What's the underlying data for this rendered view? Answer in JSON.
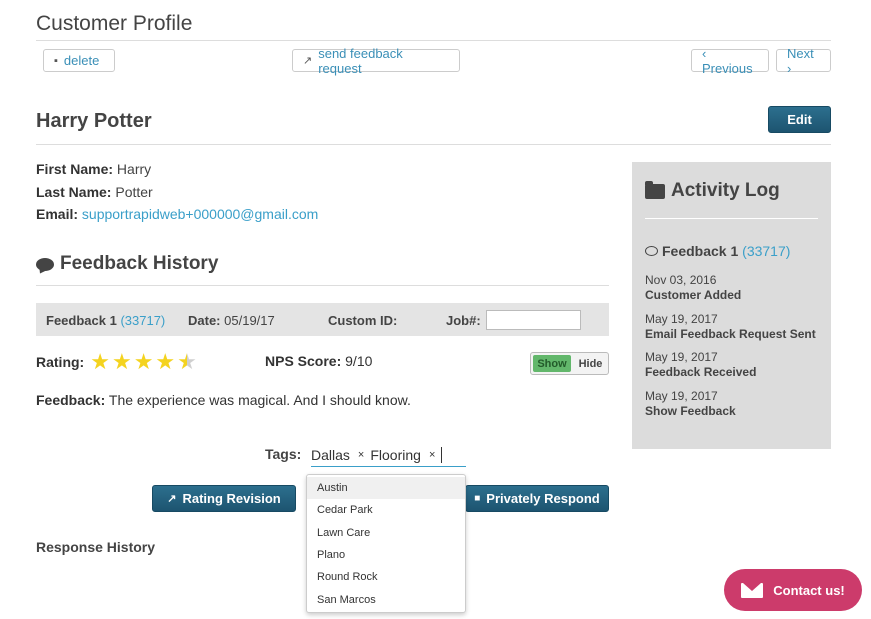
{
  "page": {
    "title": "Customer Profile"
  },
  "toolbar": {
    "delete_label": "delete",
    "send_feedback_label": "send feedback request",
    "previous_label": "‹ Previous",
    "next_label": "Next ›"
  },
  "customer": {
    "full_name": "Harry Potter",
    "edit_label": "Edit",
    "first_name_label": "First Name:",
    "first_name": "Harry",
    "last_name_label": "Last Name:",
    "last_name": "Potter",
    "email_label": "Email:",
    "email": "supportrapidweb+000000@gmail.com"
  },
  "feedback_history": {
    "title": "Feedback History",
    "feedback_label": "Feedback 1",
    "feedback_id": "(33717)",
    "date_label": "Date:",
    "date": "05/19/17",
    "custom_id_label": "Custom ID:",
    "job_label": "Job#:",
    "job_value": "",
    "rating_label": "Rating:",
    "rating_value": 4.5,
    "rating_max": 5,
    "nps_label": "NPS Score:",
    "nps_value": "9/10",
    "toggle_show": "Show",
    "toggle_hide": "Hide",
    "feedback_text_label": "Feedback:",
    "feedback_text": "The experience was magical. And I should know.",
    "tags_label": "Tags:",
    "tags": [
      "Dallas",
      "Flooring"
    ],
    "tag_remove": "×",
    "tag_options": [
      "Austin",
      "Cedar Park",
      "Lawn Care",
      "Plano",
      "Round Rock",
      "San Marcos"
    ],
    "rating_revision_label": "Rating Revision",
    "privately_respond_label": "Privately Respond",
    "response_history_label": "Response History"
  },
  "activity_log": {
    "title": "Activity Log",
    "feedback_label": "Feedback 1",
    "feedback_id": "(33717)",
    "entries": [
      {
        "date": "Nov 03, 2016",
        "event": "Customer Added"
      },
      {
        "date": "May 19, 2017",
        "event": "Email Feedback Request Sent"
      },
      {
        "date": "May 19, 2017",
        "event": "Feedback Received"
      },
      {
        "date": "May 19, 2017",
        "event": "Show Feedback"
      }
    ]
  },
  "contact": {
    "label": "Contact us!"
  },
  "colors": {
    "accent": "#3a9fc9",
    "dark_button": "#1d5470",
    "contact": "#cc3b6b",
    "toggle_on": "#62b76b",
    "star": "#f4d31f"
  }
}
